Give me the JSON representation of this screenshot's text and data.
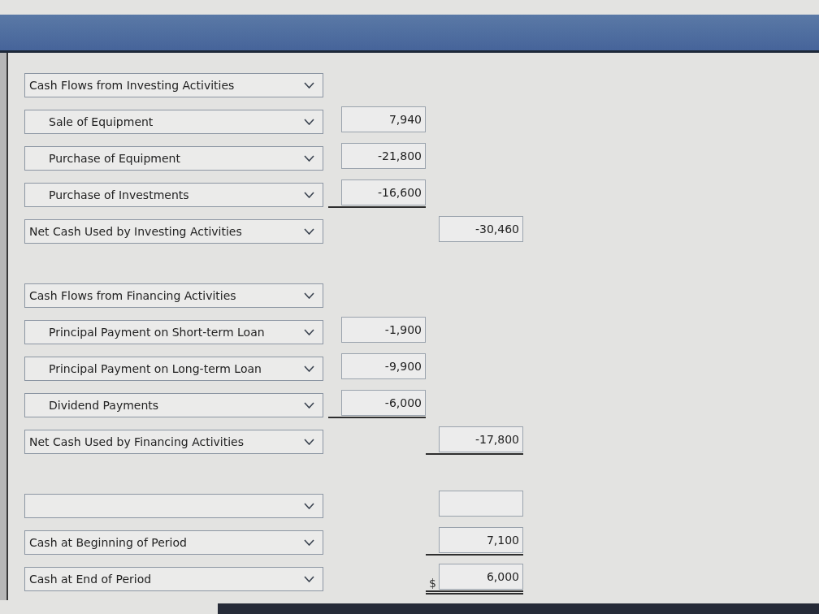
{
  "sections": [
    {
      "rows": [
        {
          "kind": "heading",
          "label": "Cash Flows from Investing Activities"
        },
        {
          "kind": "item",
          "label": "Sale of Equipment",
          "amount": "7,940",
          "underlined": false,
          "double_underlined": false
        },
        {
          "kind": "item",
          "label": "Purchase of Equipment",
          "amount": "-21,800",
          "underlined": false,
          "double_underlined": false
        },
        {
          "kind": "item",
          "label": "Purchase of Investments",
          "amount": "-16,600",
          "underlined": true,
          "double_underlined": false
        },
        {
          "kind": "total",
          "label": "Net Cash Used by Investing Activities",
          "amount": "-30,460",
          "underlined": false,
          "double_underlined": false
        }
      ]
    },
    {
      "rows": [
        {
          "kind": "heading",
          "label": "Cash Flows from Financing Activities"
        },
        {
          "kind": "item",
          "label": "Principal Payment on Short-term Loan",
          "amount": "-1,900",
          "underlined": false,
          "double_underlined": false
        },
        {
          "kind": "item",
          "label": "Principal Payment on Long-term Loan",
          "amount": "-9,900",
          "underlined": false,
          "double_underlined": false
        },
        {
          "kind": "item",
          "label": "Dividend Payments",
          "amount": "-6,000",
          "underlined": true,
          "double_underlined": false
        },
        {
          "kind": "total",
          "label": "Net Cash Used by Financing Activities",
          "amount": "-17,800",
          "underlined": true,
          "double_underlined": false
        }
      ]
    },
    {
      "rows": [
        {
          "kind": "total",
          "underlined": false,
          "double_underlined": false
        },
        {
          "kind": "total",
          "label": "Cash at Beginning of Period",
          "amount": "7,100",
          "underlined": true,
          "double_underlined": false
        },
        {
          "kind": "total",
          "label": "Cash at End of Period",
          "amount": "6,000",
          "currency": "$",
          "underlined": true,
          "double_underlined": true
        }
      ]
    }
  ]
}
